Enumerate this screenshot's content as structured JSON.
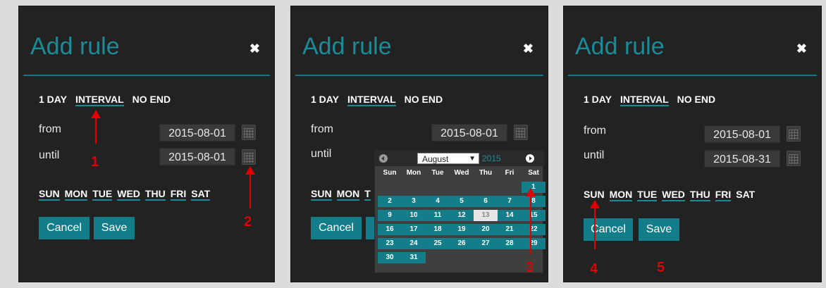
{
  "dialog": {
    "title": "Add rule",
    "close_glyph": "✖",
    "modes": [
      "1 DAY",
      "INTERVAL",
      "NO END"
    ],
    "active_mode": "INTERVAL",
    "from_label": "from",
    "until_label": "until",
    "weekdays": [
      "SUN",
      "MON",
      "TUE",
      "WED",
      "THU",
      "FRI",
      "SAT"
    ],
    "cancel_label": "Cancel",
    "save_label": "Save"
  },
  "panels": [
    {
      "from_value": "2015-08-01",
      "until_value": "2015-08-01",
      "sun_selected": true
    },
    {
      "from_value": "2015-08-01",
      "until_value": "",
      "sun_selected": true
    },
    {
      "from_value": "2015-08-01",
      "until_value": "2015-08-31",
      "sun_selected": false
    }
  ],
  "calendar": {
    "month": "August",
    "year": "2015",
    "weekday_headers": [
      "Sun",
      "Mon",
      "Tue",
      "Wed",
      "Thu",
      "Fri",
      "Sat"
    ],
    "today": "13",
    "days": [
      "1",
      "2",
      "3",
      "4",
      "5",
      "6",
      "7",
      "8",
      "9",
      "10",
      "11",
      "12",
      "13",
      "14",
      "15",
      "16",
      "17",
      "18",
      "19",
      "20",
      "21",
      "22",
      "23",
      "24",
      "25",
      "26",
      "27",
      "28",
      "29",
      "30",
      "31"
    ]
  },
  "steps": [
    "1",
    "2",
    "3",
    "4",
    "5"
  ],
  "icons": {
    "close": "close-icon",
    "calendar": "calendar-icon",
    "prev": "prev-month-icon",
    "next": "next-month-icon",
    "arrow": "arrow-up-icon"
  },
  "colors": {
    "accent": "#1a8c98",
    "button": "#137e89",
    "panel": "#222222",
    "annotation": "#e00000"
  }
}
